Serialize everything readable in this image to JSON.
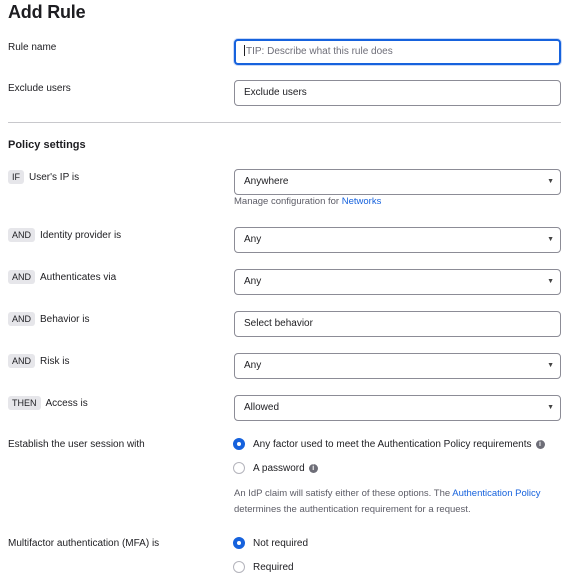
{
  "page_title": "Add Rule",
  "rule_name": {
    "label": "Rule name",
    "placeholder": "TIP: Describe what this rule does"
  },
  "exclude_users": {
    "label": "Exclude users",
    "value": "Exclude users"
  },
  "policy_settings": {
    "heading": "Policy settings"
  },
  "conditions": [
    {
      "operator": "IF",
      "label": "User's IP is",
      "value": "Anywhere"
    },
    {
      "operator": "AND",
      "label": "Identity provider is",
      "value": "Any"
    },
    {
      "operator": "AND",
      "label": "Authenticates via",
      "value": "Any"
    },
    {
      "operator": "AND",
      "label": "Behavior is",
      "value": "Select behavior"
    },
    {
      "operator": "AND",
      "label": "Risk is",
      "value": "Any"
    },
    {
      "operator": "THEN",
      "label": "Access is",
      "value": "Allowed"
    }
  ],
  "networks_helper": {
    "text": "Manage configuration for ",
    "link": "Networks"
  },
  "session": {
    "label": "Establish the user session with",
    "options": [
      {
        "label": "Any factor used to meet the Authentication Policy requirements",
        "selected": true
      },
      {
        "label": "A password",
        "selected": false
      }
    ],
    "helper_line1": "An IdP claim will satisfy either of these options. The ",
    "helper_link": "Authentication Policy",
    "helper_line2": "determines the authentication requirement for a request."
  },
  "mfa": {
    "label": "Multifactor authentication (MFA) is",
    "options": [
      {
        "label": "Not required",
        "selected": true
      },
      {
        "label": "Required",
        "selected": false
      }
    ]
  },
  "icons": {
    "info": "info-icon",
    "dropdown": "chevron-down-icon"
  },
  "colors": {
    "accent": "#1662dd",
    "chip_bg": "#e6e6ea"
  }
}
